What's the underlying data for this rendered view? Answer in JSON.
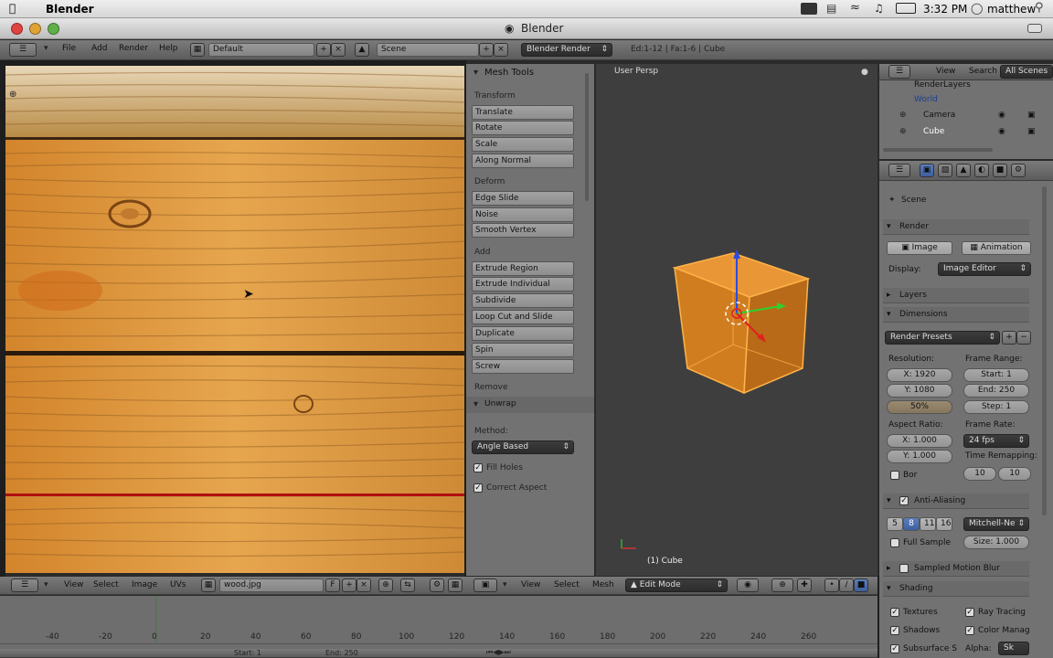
{
  "mac_menubar": {
    "app_name": "Blender",
    "clock": "3:32 PM",
    "user": "matthew"
  },
  "window": {
    "title": "Blender"
  },
  "info_header": {
    "menus": [
      "File",
      "Add",
      "Render",
      "Help"
    ],
    "screen_layout": "Default",
    "scene": "Scene",
    "render_engine": "Blender Render",
    "stats": "Ed:1-12 | Fa:1-6 | Cube"
  },
  "tool_shelf": {
    "title": "Mesh Tools",
    "sections": {
      "transform": "Transform",
      "deform": "Deform",
      "add": "Add",
      "remove": "Remove"
    },
    "transform_buttons": [
      "Translate",
      "Rotate",
      "Scale",
      "Along Normal"
    ],
    "deform_buttons": [
      "Edge Slide",
      "Noise",
      "Smooth Vertex"
    ],
    "add_buttons": [
      "Extrude Region",
      "Extrude Individual",
      "Subdivide",
      "Loop Cut and Slide",
      "Duplicate",
      "Spin",
      "Screw"
    ],
    "unwrap": {
      "title": "Unwrap",
      "method_label": "Method:",
      "method_value": "Angle Based",
      "fill_holes": "Fill Holes",
      "correct_aspect": "Correct Aspect"
    }
  },
  "viewport": {
    "view_label": "User Persp",
    "object_label": "(1) Cube",
    "accent": "#f29a1f"
  },
  "outliner": {
    "menus": [
      "View",
      "Search",
      "All Scenes"
    ],
    "items": [
      "RenderLayers",
      "World",
      "Camera",
      "Cube"
    ]
  },
  "properties": {
    "scene_path": "Scene",
    "render_panel": "Render",
    "image_button": "Image",
    "animation_button": "Animation",
    "display_label": "Display:",
    "display_value": "Image Editor",
    "layers_panel": "Layers",
    "dimensions_panel": "Dimensions",
    "render_presets": "Render Presets",
    "resolution_label": "Resolution:",
    "res_x": "X: 1920",
    "res_y": "Y: 1080",
    "res_pct": "50%",
    "frame_range_label": "Frame Range:",
    "start": "Start: 1",
    "end": "End: 250",
    "step": "Step: 1",
    "aspect_label": "Aspect Ratio:",
    "aspect_x": "X: 1.000",
    "aspect_y": "Y: 1.000",
    "frame_rate_label": "Frame Rate:",
    "frame_rate": "24 fps",
    "time_remap_label": "Time Remapping:",
    "remap_old": "10",
    "remap_new": "10",
    "border_label": "Bor",
    "antialias_panel": "Anti-Aliasing",
    "aa_samples": [
      "5",
      "8",
      "11",
      "16"
    ],
    "aa_filter": "Mitchell-Ne",
    "full_sample": "Full Sample",
    "size": "Size: 1.000",
    "motion_blur_panel": "Sampled Motion Blur",
    "shading_panel": "Shading",
    "shading_opts": [
      "Textures",
      "Ray Tracing",
      "Shadows",
      "Color Manag",
      "Subsurface S",
      "Alpha:",
      "Sk"
    ]
  },
  "image_editor_header": {
    "menus": [
      "View",
      "Select",
      "Image",
      "UVs"
    ],
    "image_name": "wood.jpg",
    "f_button": "F"
  },
  "view3d_header": {
    "menus": [
      "View",
      "Select",
      "Mesh"
    ],
    "mode": "Edit Mode"
  },
  "timeline": {
    "ticks": [
      "-40",
      "-20",
      "0",
      "20",
      "40",
      "60",
      "80",
      "100",
      "120",
      "140",
      "160",
      "180",
      "200",
      "220",
      "240",
      "260"
    ],
    "start_field": "Start: 1",
    "end_field": "End: 250"
  }
}
